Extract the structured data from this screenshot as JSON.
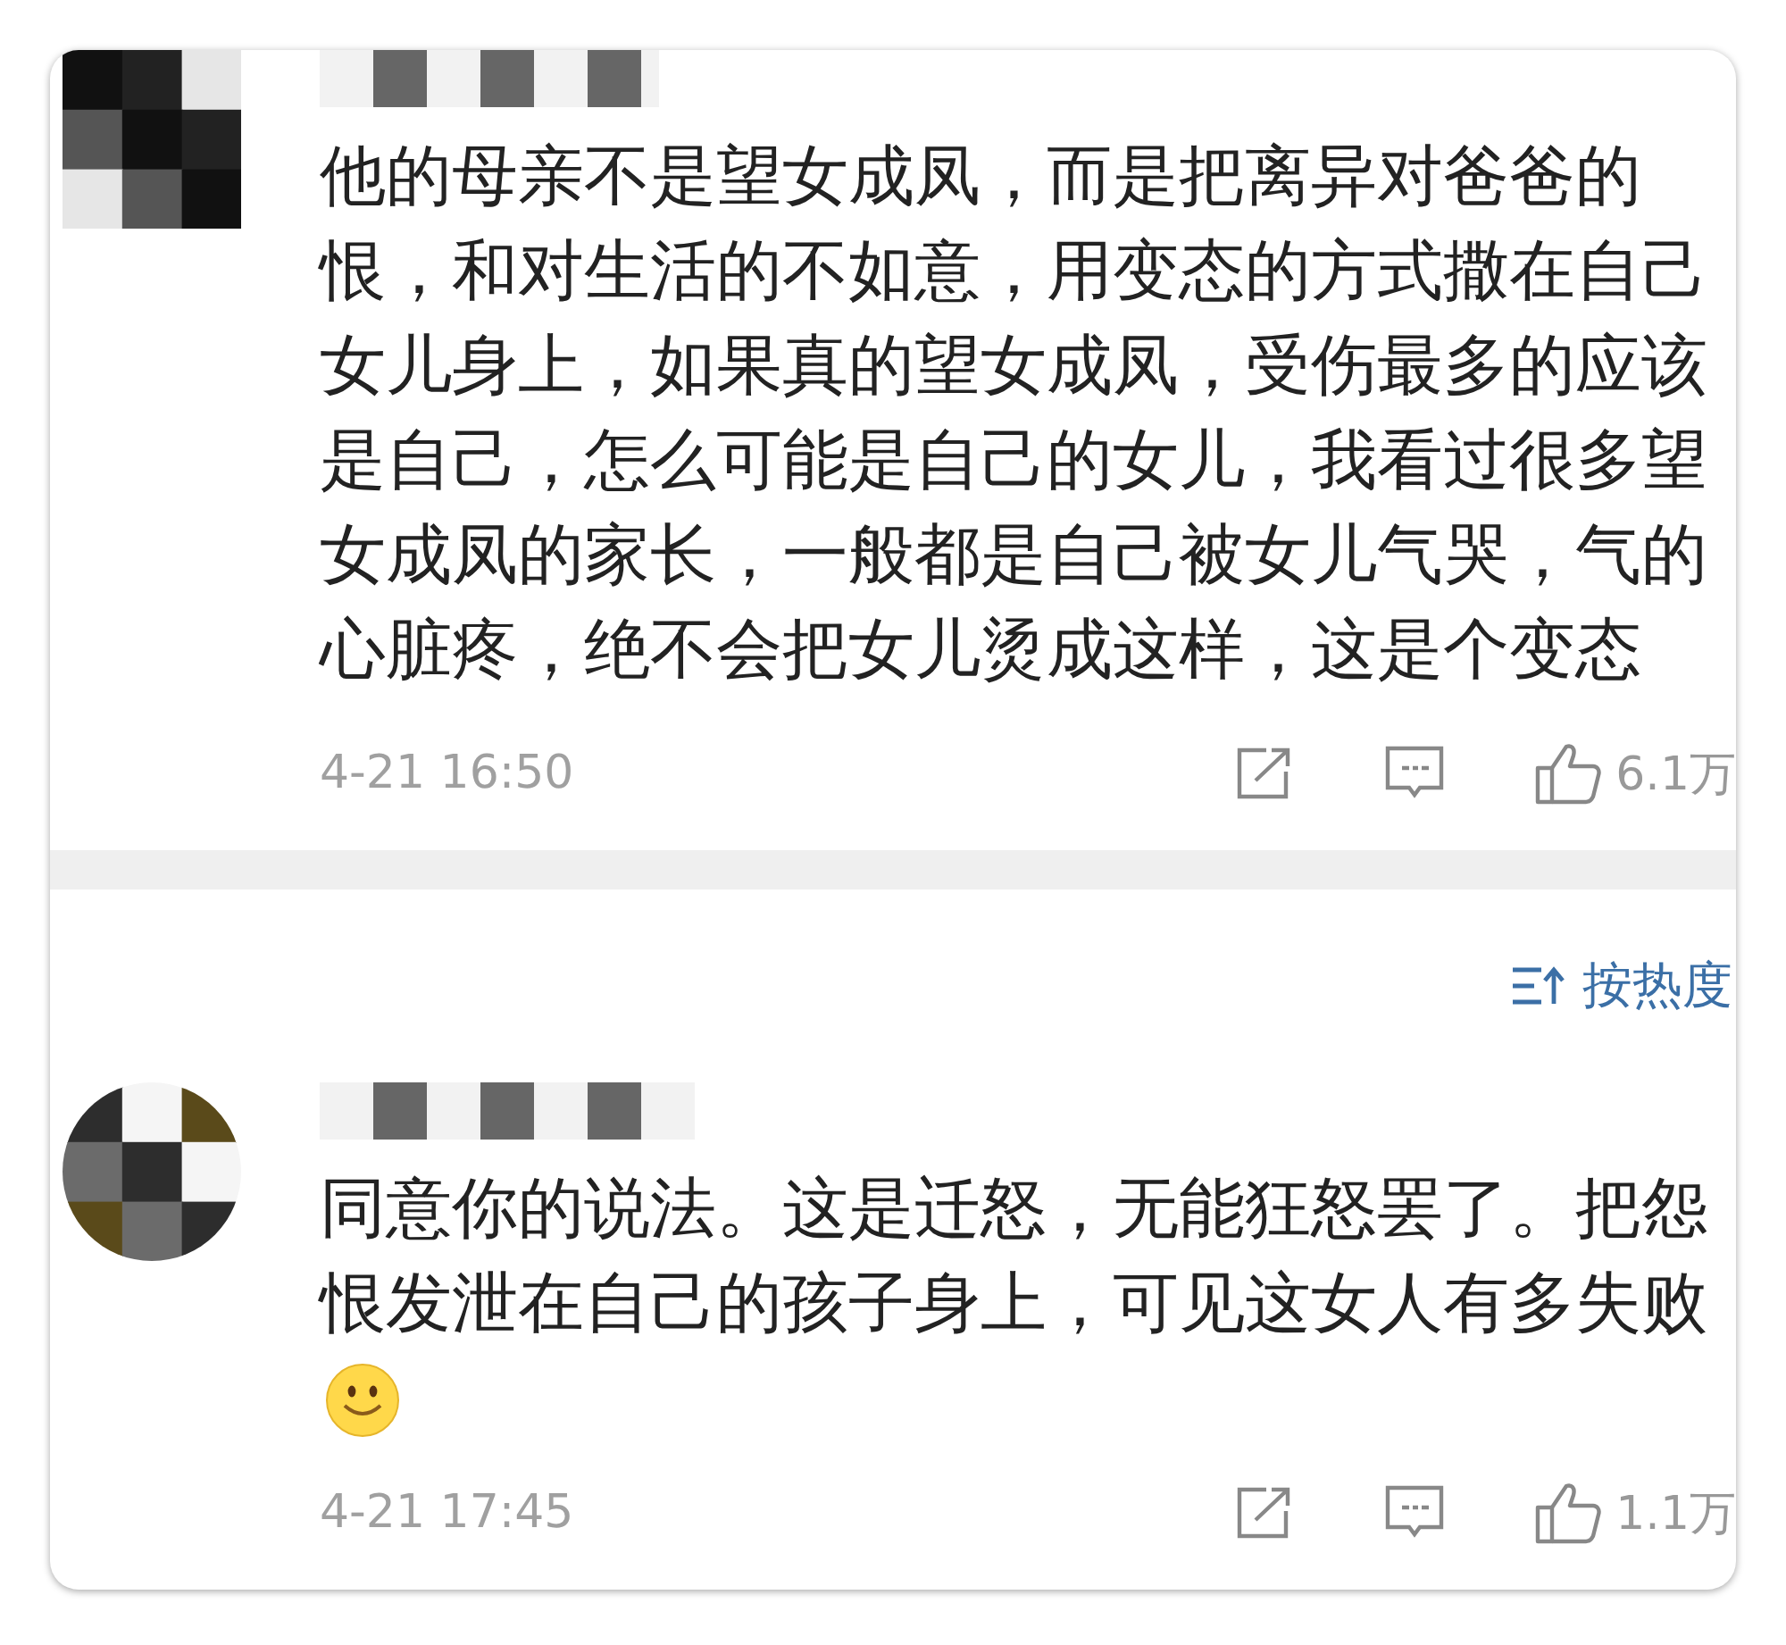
{
  "pinned_comment": {
    "text": "他的母亲不是望女成凤，而是把离异对爸爸的恨，和对生活的不如意，用变态的方式撒在自己女儿身上，如果真的望女成凤，受伤最多的应该是自己，怎么可能是自己的女儿，我看过很多望女成凤的家长，一般都是自己被女儿气哭，气的心脏疼，绝不会把女儿烫成这样，这是个变态",
    "time": "4-21 16:50",
    "likes": "6.1万"
  },
  "sort": {
    "label": "按热度"
  },
  "comments": [
    {
      "text": "同意你的说法。这是迁怒，无能狂怒罢了。把怨恨发泄在自己的孩子身上，可见这女人有多失败",
      "emoji": true,
      "time": "4-21 17:45",
      "likes": "1.1万"
    }
  ]
}
